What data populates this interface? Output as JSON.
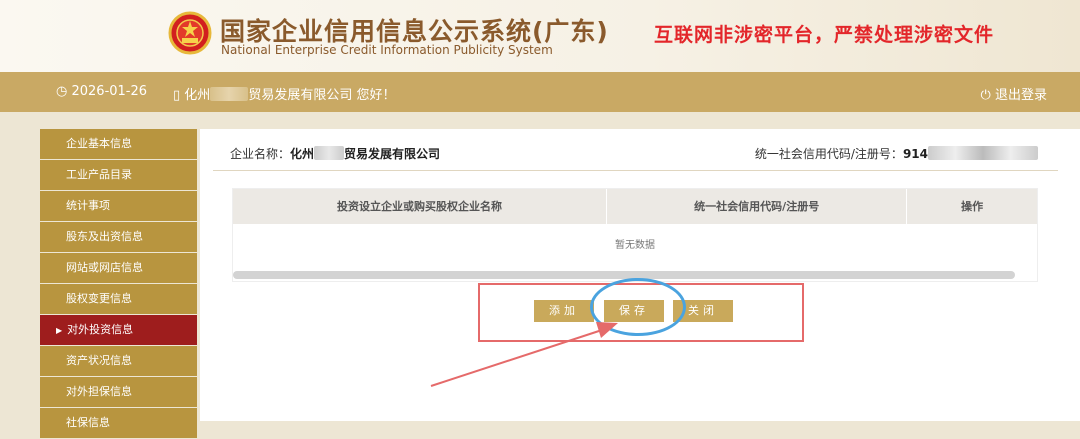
{
  "header": {
    "title_zh": "国家企业信用信息公示系统(广东)",
    "title_en": "National Enterprise Credit Information Publicity System",
    "warning": "互联网非涉密平台，严禁处理涉密文件",
    "emblem_icon": "national-emblem-icon"
  },
  "topbar": {
    "date": "2026-01-26",
    "welcome_prefix": "化州",
    "welcome_suffix": "贸易发展有限公司 您好！",
    "logout": "退出登录"
  },
  "sidebar": {
    "items": [
      {
        "label": "企业基本信息"
      },
      {
        "label": "工业产品目录"
      },
      {
        "label": "统计事项"
      },
      {
        "label": "股东及出资信息"
      },
      {
        "label": "网站或网店信息"
      },
      {
        "label": "股权变更信息"
      },
      {
        "label": "对外投资信息",
        "active": true
      },
      {
        "label": "资产状况信息"
      },
      {
        "label": "对外担保信息"
      },
      {
        "label": "社保信息"
      }
    ]
  },
  "main": {
    "company_label": "企业名称：",
    "company_prefix": "化州",
    "company_suffix": "贸易发展有限公司",
    "credit_label": "统一社会信用代码/注册号：",
    "credit_prefix": "914",
    "table": {
      "columns": [
        "投资设立企业或购买股权企业名称",
        "统一社会信用代码/注册号",
        "操作"
      ],
      "empty_text": "暂无数据"
    },
    "buttons": {
      "add": "添加",
      "save": "保存",
      "close": "关闭"
    }
  },
  "colors": {
    "gold": "#c9a964",
    "sidebar": "#b8953f",
    "active": "#9e1d1d",
    "warning": "#e3262a",
    "annotation_red": "#e56a6a",
    "annotation_blue": "#4aa3df"
  }
}
